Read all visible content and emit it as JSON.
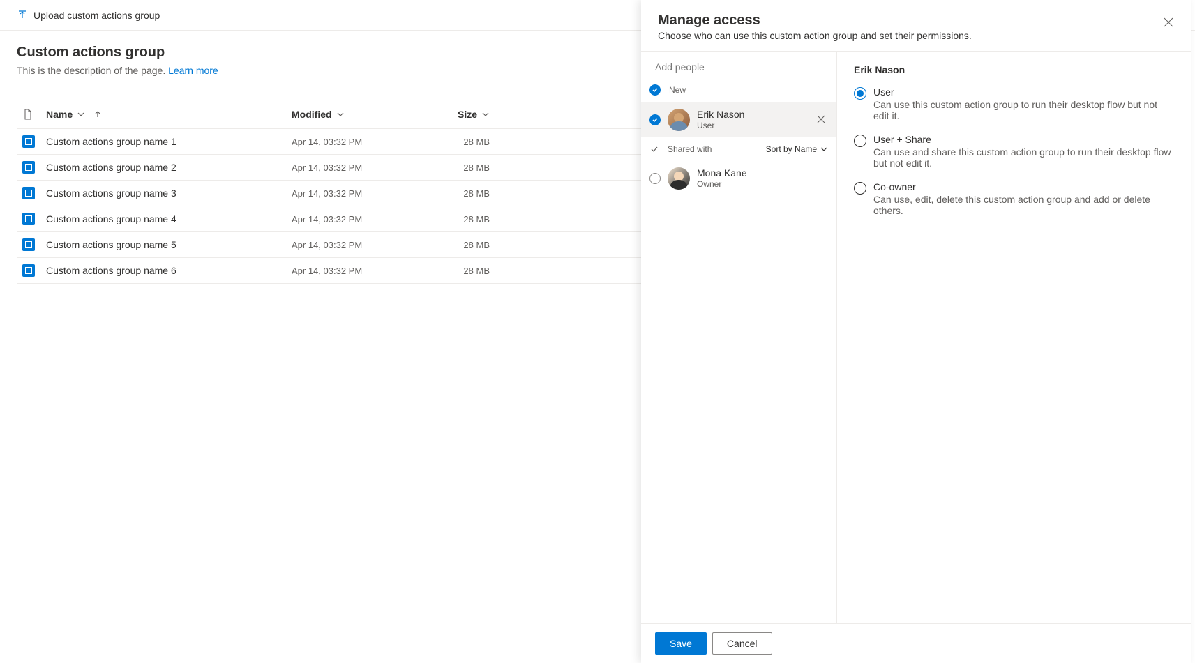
{
  "commandBar": {
    "upload": "Upload custom actions group"
  },
  "page": {
    "title": "Custom actions group",
    "description": "This is the description of the page. ",
    "learnMore": "Learn more"
  },
  "table": {
    "headers": {
      "name": "Name",
      "modified": "Modified",
      "size": "Size"
    },
    "rows": [
      {
        "name": "Custom actions group name 1",
        "modified": "Apr 14, 03:32 PM",
        "size": "28 MB"
      },
      {
        "name": "Custom actions group name 2",
        "modified": "Apr 14, 03:32 PM",
        "size": "28 MB"
      },
      {
        "name": "Custom actions group name 3",
        "modified": "Apr 14, 03:32 PM",
        "size": "28 MB"
      },
      {
        "name": "Custom actions group name 4",
        "modified": "Apr 14, 03:32 PM",
        "size": "28 MB"
      },
      {
        "name": "Custom actions group name 5",
        "modified": "Apr 14, 03:32 PM",
        "size": "28 MB"
      },
      {
        "name": "Custom actions group name 6",
        "modified": "Apr 14, 03:32 PM",
        "size": "28 MB"
      }
    ]
  },
  "panel": {
    "title": "Manage access",
    "subtitle": "Choose who can use this custom action group and set their permissions.",
    "addPlaceholder": "Add people",
    "newLabel": "New",
    "sharedWithLabel": "Shared with",
    "sortLabel": "Sort by Name",
    "newPeople": [
      {
        "name": "Erik Nason",
        "role": "User",
        "selected": true
      }
    ],
    "sharedPeople": [
      {
        "name": "Mona Kane",
        "role": "Owner",
        "selected": false
      }
    ],
    "permissions": {
      "person": "Erik Nason",
      "options": [
        {
          "label": "User",
          "desc": "Can use this custom action group to run their desktop flow but not edit it.",
          "checked": true
        },
        {
          "label": "User + Share",
          "desc": "Can use and share this custom action group to run their desktop flow but not edit it.",
          "checked": false
        },
        {
          "label": "Co-owner",
          "desc": "Can use, edit, delete this custom action group and add or delete others.",
          "checked": false
        }
      ]
    },
    "footer": {
      "save": "Save",
      "cancel": "Cancel"
    }
  }
}
